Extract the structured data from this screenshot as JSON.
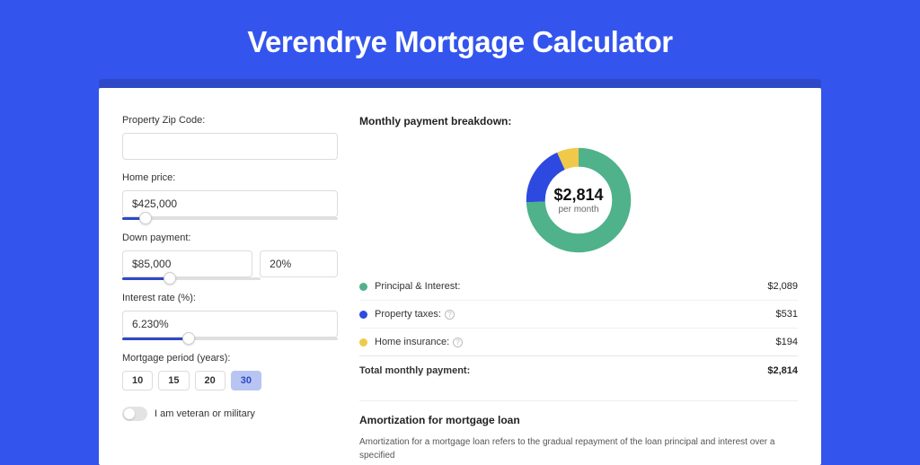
{
  "title": "Verendrye Mortgage Calculator",
  "form": {
    "zip_label": "Property Zip Code:",
    "zip_value": "",
    "home_price_label": "Home price:",
    "home_price_value": "$425,000",
    "down_payment_label": "Down payment:",
    "down_payment_value": "$85,000",
    "down_payment_pct": "20%",
    "interest_label": "Interest rate (%):",
    "interest_value": "6.230%",
    "period_label": "Mortgage period (years):",
    "periods": [
      "10",
      "15",
      "20",
      "30"
    ],
    "period_active": "30",
    "veteran_label": "I am veteran or military"
  },
  "breakdown": {
    "heading": "Monthly payment breakdown:",
    "center_amount": "$2,814",
    "center_sub": "per month",
    "items": [
      {
        "label": "Principal & Interest:",
        "value": "$2,089",
        "color": "#4fb28a",
        "info": false
      },
      {
        "label": "Property taxes:",
        "value": "$531",
        "color": "#2e49e0",
        "info": true
      },
      {
        "label": "Home insurance:",
        "value": "$194",
        "color": "#f0c94a",
        "info": true
      }
    ],
    "total_label": "Total monthly payment:",
    "total_value": "$2,814"
  },
  "amortization": {
    "heading": "Amortization for mortgage loan",
    "text": "Amortization for a mortgage loan refers to the gradual repayment of the loan principal and interest over a specified"
  },
  "chart_data": {
    "type": "pie",
    "title": "Monthly payment breakdown",
    "series": [
      {
        "name": "Principal & Interest",
        "value": 2089,
        "color": "#4fb28a"
      },
      {
        "name": "Property taxes",
        "value": 531,
        "color": "#2e49e0"
      },
      {
        "name": "Home insurance",
        "value": 194,
        "color": "#f0c94a"
      }
    ],
    "total": 2814
  }
}
